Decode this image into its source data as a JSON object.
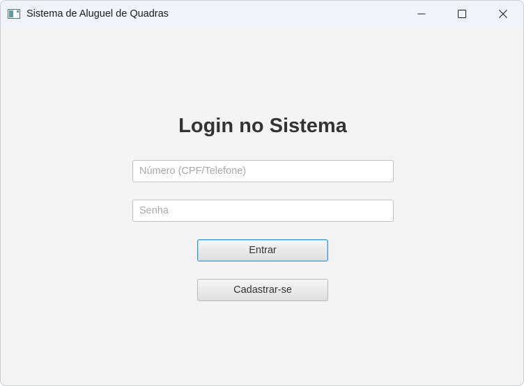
{
  "window": {
    "title": "Sistema de Aluguel de Quadras",
    "icon": "app-window-icon",
    "controls": {
      "minimize": "minimize-icon",
      "maximize": "maximize-icon",
      "close": "close-icon"
    }
  },
  "login": {
    "heading": "Login no Sistema",
    "user_field": {
      "value": "",
      "placeholder": "Número (CPF/Telefone)"
    },
    "password_field": {
      "value": "",
      "placeholder": "Senha"
    },
    "enter_label": "Entrar",
    "register_label": "Cadastrar-se"
  },
  "colors": {
    "background": "#f4f4f4",
    "titlebar": "#f0f4f9",
    "focus_accent": "#3b9bd6",
    "heading_text": "#333333"
  }
}
